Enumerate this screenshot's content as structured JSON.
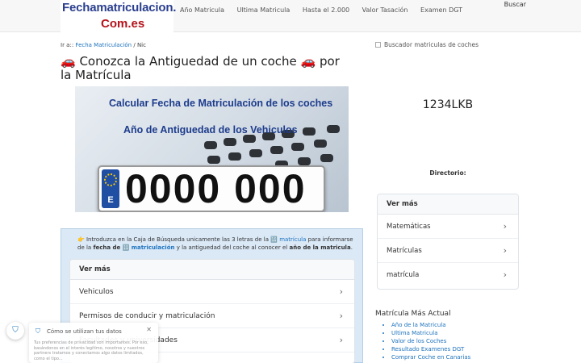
{
  "logo": {
    "line1": "Fechamatriculacion.",
    "line2": "Com.es"
  },
  "nav": [
    "Año Matricula",
    "Ultima Matricula",
    "Hasta el 2.000",
    "Valor Tasación",
    "Examen DGT"
  ],
  "search_label": "Buscar",
  "breadcrumb": {
    "prefix": "Ir a::",
    "link": "Fecha Matriculación",
    "sep": "/",
    "current": "Nic"
  },
  "title": "🚗 Conozca la Antiguedad de un coche 🚗 por la Matrícula",
  "banner": {
    "line1": "Calcular Fecha de Matriculación de los coches",
    "line2": "Año de Antiguedad de los Vehiculos",
    "plate_country": "E",
    "plate_number": "0000 000"
  },
  "info": {
    "t1": "👉 Introduzca en la Caja de Búsqueda unicamente las 3 letras de la 🔢",
    "l1": "matrícula",
    "t2": "para informarse de la",
    "b1": "fecha de 🔢",
    "l2": "matriculación",
    "t3": "y la antiguedad del coche al conocer el",
    "b2": "año de la matricula",
    "t4": "."
  },
  "ver_mas": {
    "heading": "Ver más",
    "items": [
      "Vehiculos",
      "Permisos de conducir y matriculación",
      "Facultades y universidades"
    ]
  },
  "sidebar": {
    "finder_alt": "Buscador matriculas de coches",
    "plate_text": "1234LKB",
    "directory": "Directorio:",
    "ver_mas_heading": "Ver más",
    "ver_mas_items": [
      "Matemáticas",
      "Matrículas",
      "matrícula"
    ],
    "latest_heading": "Matrícula Más Actual",
    "latest_items": [
      "Año de la Matricula",
      "Ultima Matricula",
      "Valor de los Coches",
      "Resultado Examenes DGT",
      "Comprar Coche en Canarias"
    ]
  },
  "cookie": {
    "title": "Cómo se utilizan tus datos",
    "body": "Tus preferencias de privacidad son importantes. Por eso, basándonos en el interés legítimo, nosotros y nuestros partners tratamos y conectamos algo datos limitados, como el tipo..."
  },
  "colors": {
    "accent": "#1e73be",
    "logo_blue": "#2b3f8e",
    "logo_red": "#b5121b",
    "info_bg": "#dbe9f7"
  }
}
